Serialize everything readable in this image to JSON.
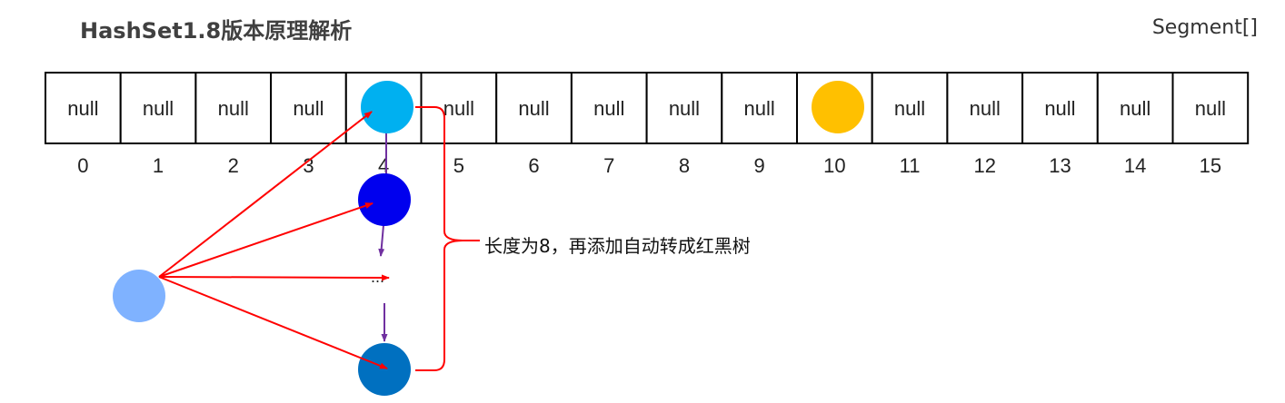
{
  "title": "HashSet1.8版本原理解析",
  "segment_label": "Segment[]",
  "array": {
    "cells": [
      "null",
      "null",
      "null",
      "null",
      "",
      "null",
      "null",
      "null",
      "null",
      "null",
      "",
      "null",
      "null",
      "null",
      "null",
      "null"
    ],
    "indices": [
      "0",
      "1",
      "2",
      "3",
      "4",
      "5",
      "6",
      "7",
      "8",
      "9",
      "10",
      "11",
      "12",
      "13",
      "14",
      "15"
    ]
  },
  "chain_ellipsis": "...",
  "annotation": "长度为8，再添加自动转成红黑树",
  "colors": {
    "bucket4_node": "#00b0f0",
    "bucket10_node": "#ffc000",
    "chain_node_2": "#0000ee",
    "chain_node_last": "#0070c0",
    "new_node": "#7fb2ff",
    "insert_arrow": "#ff0000",
    "chain_arrow": "#7030a0"
  }
}
